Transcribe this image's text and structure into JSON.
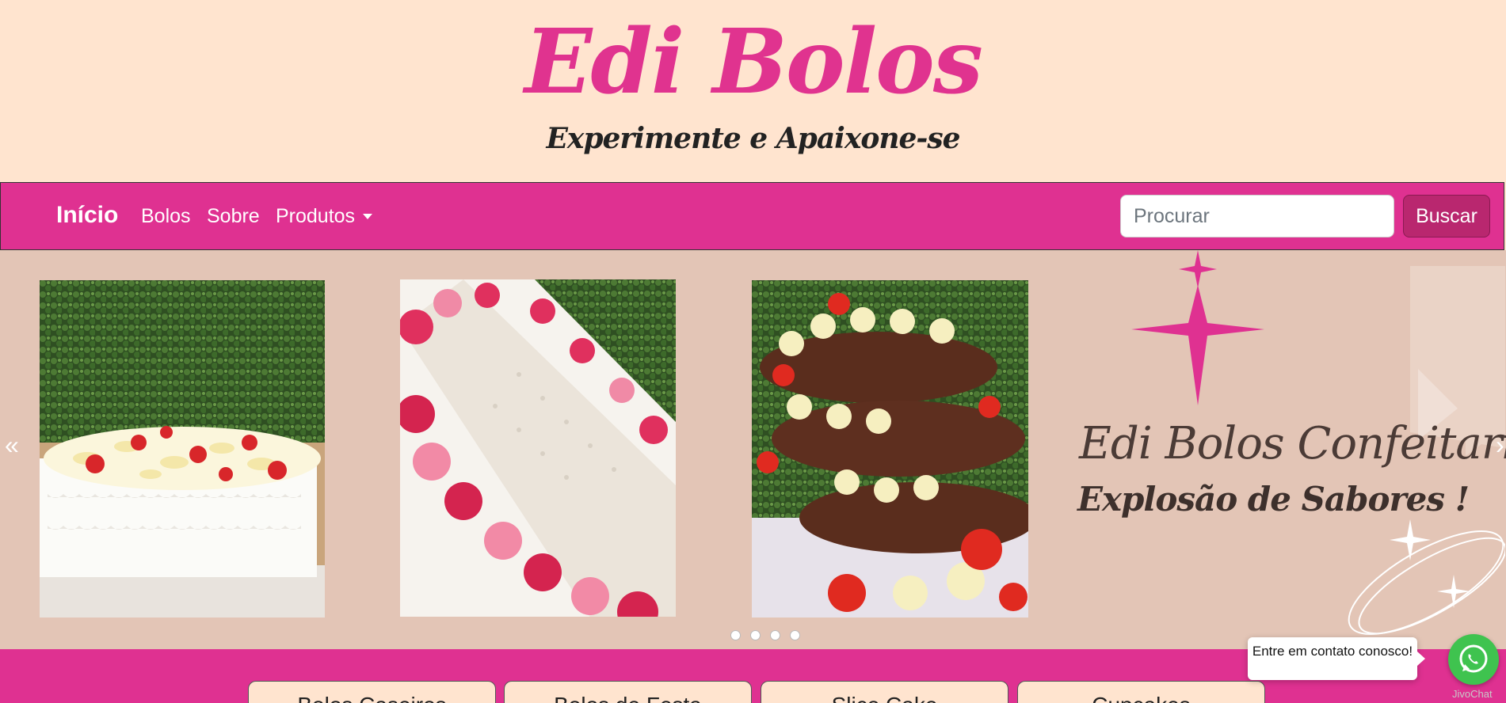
{
  "header": {
    "brand_title": "Edi Bolos",
    "tagline": "Experimente e Apaixone-se"
  },
  "nav": {
    "home_label": "Início",
    "links": [
      "Bolos",
      "Sobre",
      "Produtos"
    ],
    "search_placeholder": "Procurar",
    "search_button": "Buscar"
  },
  "carousel": {
    "prev_icon": "«",
    "next_icon": "›",
    "banner_name": "Edi Bolos Confeitaria",
    "banner_slogan": "Explosão de Sabores !",
    "photos": [
      "white-strawberry-cake-photo",
      "pink-rose-cake-photo",
      "chocolate-naked-cake-photo"
    ],
    "slide_count": 4,
    "active_slide": 1
  },
  "categories": [
    "Bolos Caseiros",
    "Bolos de Festa",
    "Slice Cake",
    "Cupcakes"
  ],
  "chat": {
    "bubble_text": "Entre em contato conosco!",
    "provider": "JivoChat"
  },
  "colors": {
    "brand_pink": "#df3191",
    "cream": "#ffe4cf",
    "carousel_bg": "#e3c5b6",
    "whatsapp_green": "#3fc34f"
  }
}
